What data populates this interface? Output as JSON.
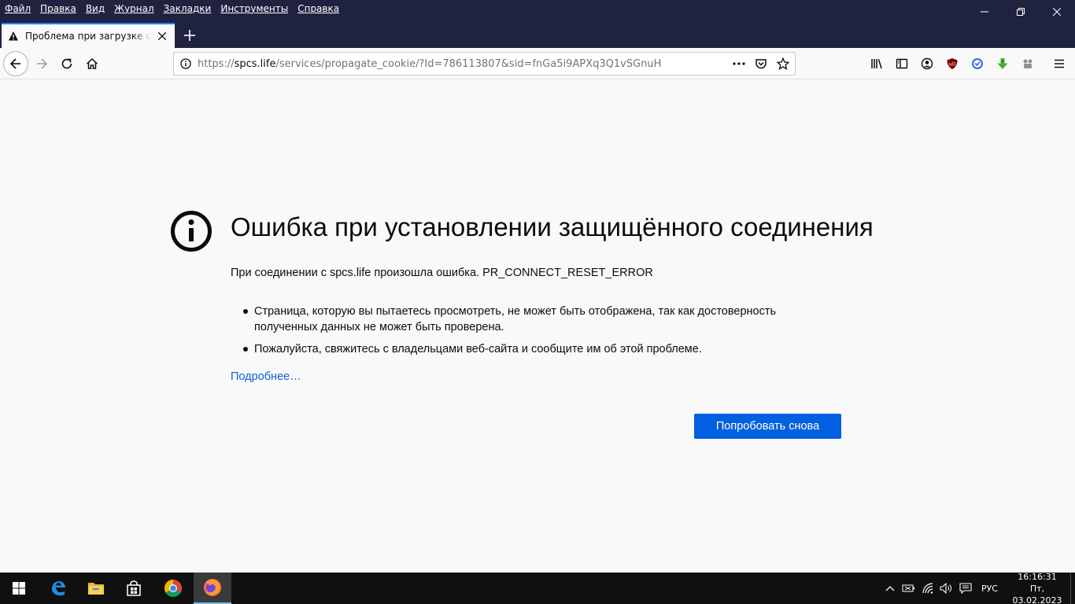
{
  "window": {
    "menu": [
      "Файл",
      "Правка",
      "Вид",
      "Журнал",
      "Закладки",
      "Инструменты",
      "Справка"
    ],
    "controls": [
      "minimize",
      "restore",
      "close"
    ]
  },
  "tab": {
    "title": "Проблема при загрузке страницы",
    "icon": "warning-icon"
  },
  "urlbar": {
    "scheme": "https://",
    "host": "spcs.life",
    "path": "/services/propagate_cookie/?Id=786113807&sid=fnGa5i9APXq3Q1vSGnuH"
  },
  "error": {
    "title": "Ошибка при установлении защищённого соединения",
    "description": "При соединении с spcs.life произошла ошибка. PR_CONNECT_RESET_ERROR",
    "bullets": [
      "Страница, которую вы пытаетесь просмотреть, не может быть отображена, так как достоверность полученных данных не может быть проверена.",
      "Пожалуйста, свяжитесь с владельцами веб-сайта и сообщите им об этой проблеме."
    ],
    "learn_more": "Подробнее…",
    "retry_label": "Попробовать снова"
  },
  "taskbar": {
    "apps": [
      "start-icon",
      "edge-icon",
      "file-explorer-icon",
      "store-icon",
      "chrome-icon",
      "firefox-icon"
    ],
    "active_app": "firefox-icon",
    "language": "РУС",
    "time": "16:16:31",
    "date": "Пт, 03.02.2023"
  },
  "colors": {
    "titlebar": "#202340",
    "accent": "#0060df",
    "link": "#0a62d8",
    "page_bg": "#f9f9fa"
  }
}
